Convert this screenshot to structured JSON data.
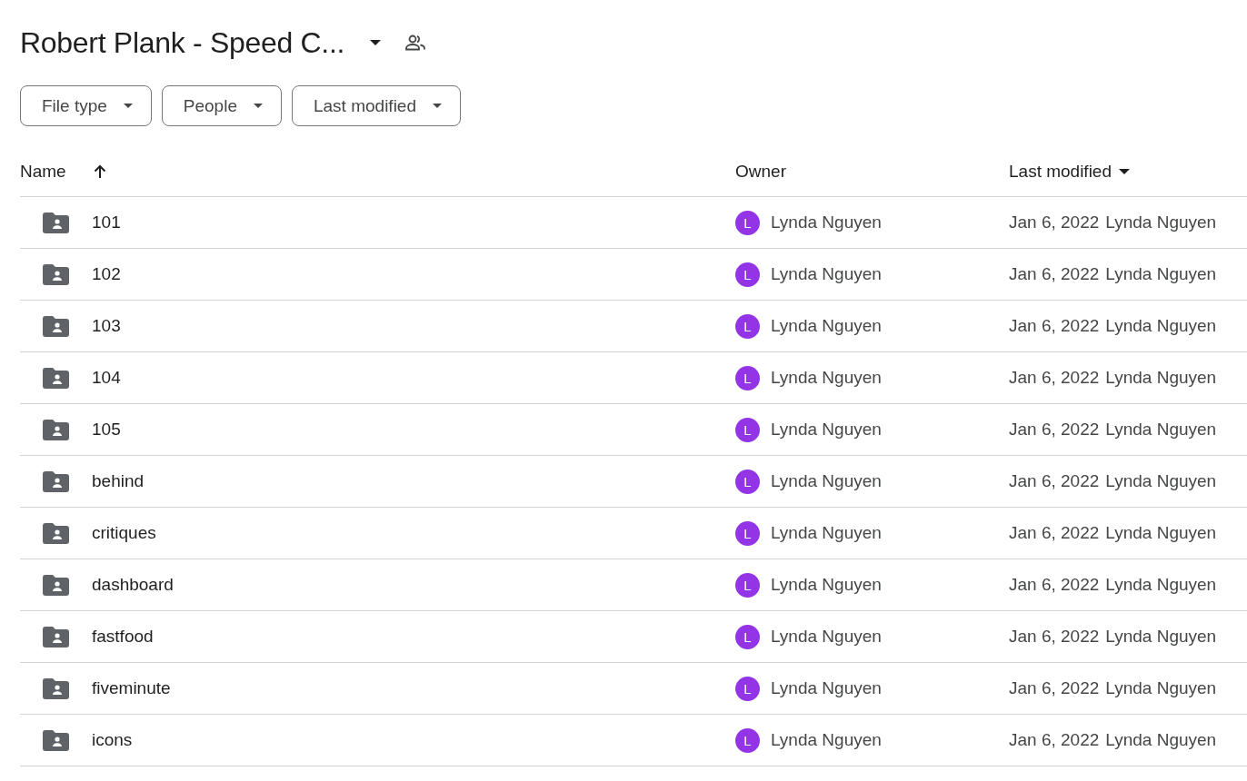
{
  "title": "Robert Plank - Speed C...",
  "filters": [
    {
      "label": "File type"
    },
    {
      "label": "People"
    },
    {
      "label": "Last modified"
    }
  ],
  "columns": [
    {
      "label": "Name",
      "sorted": true,
      "ascending": true
    },
    {
      "label": "Owner",
      "sorted": false
    },
    {
      "label": "Last modified",
      "sorted": true,
      "ascending": false
    }
  ],
  "rows": [
    {
      "name": "101",
      "owner_initial": "L",
      "owner": "Lynda Nguyen",
      "modified_date": "Jan 6, 2022",
      "modified_by": "Lynda Nguyen"
    },
    {
      "name": "102",
      "owner_initial": "L",
      "owner": "Lynda Nguyen",
      "modified_date": "Jan 6, 2022",
      "modified_by": "Lynda Nguyen"
    },
    {
      "name": "103",
      "owner_initial": "L",
      "owner": "Lynda Nguyen",
      "modified_date": "Jan 6, 2022",
      "modified_by": "Lynda Nguyen"
    },
    {
      "name": "104",
      "owner_initial": "L",
      "owner": "Lynda Nguyen",
      "modified_date": "Jan 6, 2022",
      "modified_by": "Lynda Nguyen"
    },
    {
      "name": "105",
      "owner_initial": "L",
      "owner": "Lynda Nguyen",
      "modified_date": "Jan 6, 2022",
      "modified_by": "Lynda Nguyen"
    },
    {
      "name": "behind",
      "owner_initial": "L",
      "owner": "Lynda Nguyen",
      "modified_date": "Jan 6, 2022",
      "modified_by": "Lynda Nguyen"
    },
    {
      "name": "critiques",
      "owner_initial": "L",
      "owner": "Lynda Nguyen",
      "modified_date": "Jan 6, 2022",
      "modified_by": "Lynda Nguyen"
    },
    {
      "name": "dashboard",
      "owner_initial": "L",
      "owner": "Lynda Nguyen",
      "modified_date": "Jan 6, 2022",
      "modified_by": "Lynda Nguyen"
    },
    {
      "name": "fastfood",
      "owner_initial": "L",
      "owner": "Lynda Nguyen",
      "modified_date": "Jan 6, 2022",
      "modified_by": "Lynda Nguyen"
    },
    {
      "name": "fiveminute",
      "owner_initial": "L",
      "owner": "Lynda Nguyen",
      "modified_date": "Jan 6, 2022",
      "modified_by": "Lynda Nguyen"
    },
    {
      "name": "icons",
      "owner_initial": "L",
      "owner": "Lynda Nguyen",
      "modified_date": "Jan 6, 2022",
      "modified_by": "Lynda Nguyen"
    }
  ]
}
